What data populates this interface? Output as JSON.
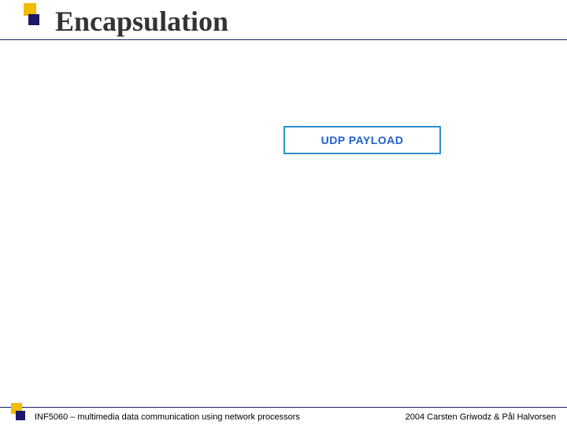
{
  "title": "Encapsulation",
  "diagram": {
    "payload_label": "UDP PAYLOAD"
  },
  "footer": {
    "course": "INF5060 – multimedia data communication using network processors",
    "credits": "2004 Carsten Griwodz & Pål Halvorsen"
  }
}
